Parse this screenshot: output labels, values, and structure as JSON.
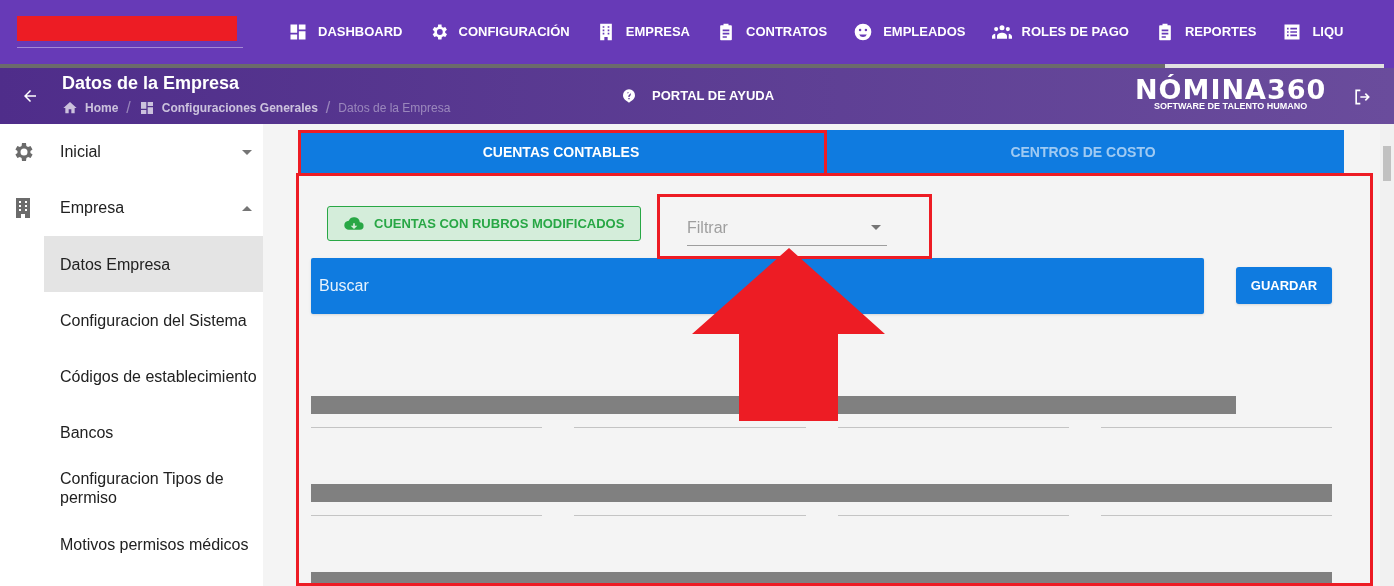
{
  "nav": {
    "items": [
      {
        "label": "DASHBOARD",
        "kind": "dashboard"
      },
      {
        "label": "CONFIGURACIÓN",
        "kind": "gear"
      },
      {
        "label": "EMPRESA",
        "kind": "building"
      },
      {
        "label": "CONTRATOS",
        "kind": "clipboard"
      },
      {
        "label": "EMPLEADOS",
        "kind": "face"
      },
      {
        "label": "ROLES DE PAGO",
        "kind": "people"
      },
      {
        "label": "REPORTES",
        "kind": "clipboard"
      },
      {
        "label": "LIQU",
        "kind": "list"
      }
    ]
  },
  "header": {
    "title": "Datos de la Empresa",
    "breadcrumbs": [
      {
        "label": "Home",
        "kind": "home"
      },
      {
        "separator": "/",
        "label": "Configuraciones Generales",
        "kind": "dashboard"
      },
      {
        "separator": "/",
        "label": "Datos de la Empresa",
        "kind": "current"
      }
    ],
    "help": "PORTAL DE AYUDA",
    "logo": {
      "name": "NÓMINA360",
      "tagline": "SOFTWARE DE TALENTO HUMANO"
    }
  },
  "sidebar": {
    "items": [
      {
        "label": "Inicial",
        "kind": "gear",
        "expanded": false
      },
      {
        "label": "Empresa",
        "kind": "building",
        "expanded": true,
        "children": [
          {
            "label": "Datos Empresa",
            "selected": true
          },
          {
            "label": "Configuracion del Sistema",
            "selected": false
          },
          {
            "label": "Códigos de establecimiento",
            "selected": false
          },
          {
            "label": "Bancos",
            "selected": false
          },
          {
            "label": "Configuracion Tipos de permiso",
            "selected": false
          },
          {
            "label": "Motivos permisos médicos",
            "selected": false
          }
        ]
      }
    ]
  },
  "tabs": [
    {
      "label": "CUENTAS CONTABLES",
      "selected": true
    },
    {
      "label": "CENTROS DE COSTO",
      "selected": false
    }
  ],
  "download_button": "CUENTAS CON RUBROS MODIFICADOS",
  "filter": {
    "placeholder": "Filtrar"
  },
  "search": {
    "placeholder": "Buscar"
  },
  "save_button": "GUARDAR",
  "field_rows": [
    {
      "kind": "partial"
    },
    {
      "kind": "full"
    },
    {
      "kind": "full"
    }
  ]
}
